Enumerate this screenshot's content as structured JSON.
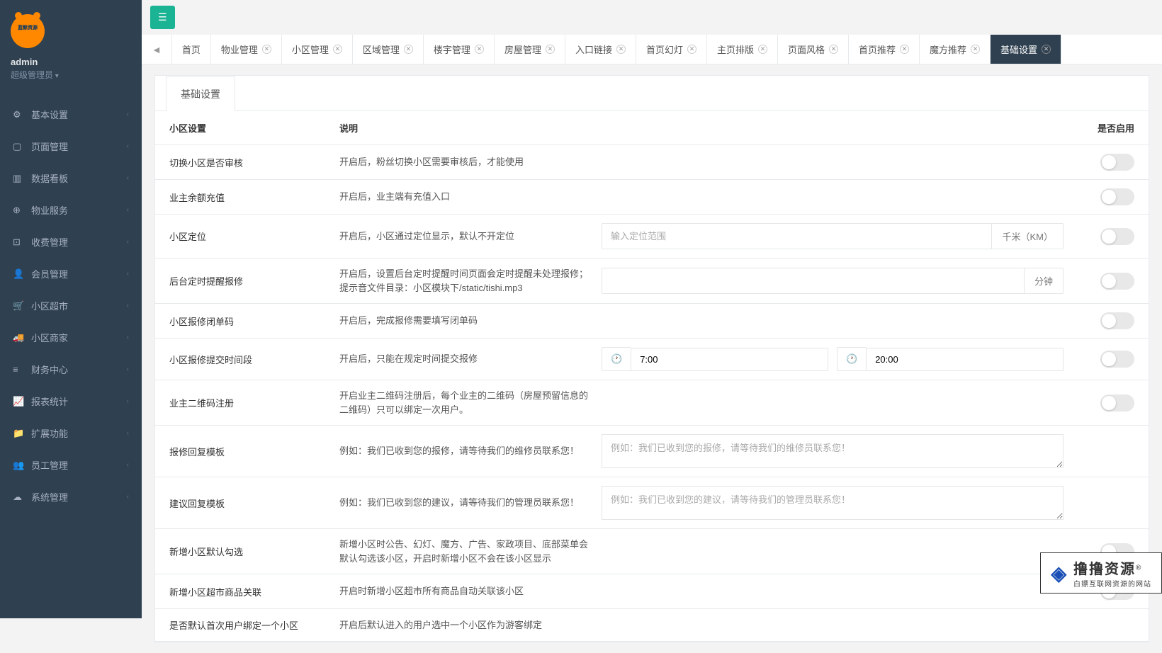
{
  "sidebar": {
    "logo_text": "蓝鲸资源",
    "username": "admin",
    "role": "超级管理员",
    "items": [
      {
        "label": "基本设置",
        "icon": "⚙"
      },
      {
        "label": "页面管理",
        "icon": "▢"
      },
      {
        "label": "数据看板",
        "icon": "▥"
      },
      {
        "label": "物业服务",
        "icon": "⊕"
      },
      {
        "label": "收费管理",
        "icon": "⊡"
      },
      {
        "label": "会员管理",
        "icon": "👤"
      },
      {
        "label": "小区超市",
        "icon": "🛒"
      },
      {
        "label": "小区商家",
        "icon": "🚚"
      },
      {
        "label": "财务中心",
        "icon": "≡"
      },
      {
        "label": "报表统计",
        "icon": "📈"
      },
      {
        "label": "扩展功能",
        "icon": "📁"
      },
      {
        "label": "员工管理",
        "icon": "👥"
      },
      {
        "label": "系统管理",
        "icon": "☁"
      }
    ]
  },
  "tabs": [
    {
      "label": "首页",
      "closable": false
    },
    {
      "label": "物业管理",
      "closable": true
    },
    {
      "label": "小区管理",
      "closable": true
    },
    {
      "label": "区域管理",
      "closable": true
    },
    {
      "label": "楼宇管理",
      "closable": true
    },
    {
      "label": "房屋管理",
      "closable": true
    },
    {
      "label": "入口链接",
      "closable": true
    },
    {
      "label": "首页幻灯",
      "closable": true
    },
    {
      "label": "主页排版",
      "closable": true
    },
    {
      "label": "页面风格",
      "closable": true
    },
    {
      "label": "首页推荐",
      "closable": true
    },
    {
      "label": "魔方推荐",
      "closable": true
    },
    {
      "label": "基础设置",
      "closable": true,
      "active": true
    }
  ],
  "panel": {
    "tab_label": "基础设置",
    "headers": {
      "name": "小区设置",
      "desc": "说明",
      "enable": "是否启用"
    }
  },
  "rows": [
    {
      "name": "切换小区是否审核",
      "desc": "开启后，粉丝切换小区需要审核后，才能使用",
      "input": null
    },
    {
      "name": "业主余额充值",
      "desc": "开启后，业主端有充值入口",
      "input": null
    },
    {
      "name": "小区定位",
      "desc": "开启后，小区通过定位显示，默认不开定位",
      "input": {
        "type": "text-addon",
        "placeholder": "输入定位范围",
        "addon": "千米（KM）"
      }
    },
    {
      "name": "后台定时提醒报修",
      "desc": "开启后，设置后台定时提醒时间页面会定时提醒未处理报修；提示音文件目录：小区模块下/static/tishi.mp3",
      "input": {
        "type": "text-addon",
        "placeholder": "",
        "addon": "分钟"
      }
    },
    {
      "name": "小区报修闭单码",
      "desc": "开启后，完成报修需要填写闭单码",
      "input": null
    },
    {
      "name": "小区报修提交时间段",
      "desc": "开启后，只能在规定时间提交报修",
      "input": {
        "type": "time-range",
        "start": "7:00",
        "end": "20:00"
      }
    },
    {
      "name": "业主二维码注册",
      "desc": "开启业主二维码注册后，每个业主的二维码（房屋预留信息的二维码）只可以绑定一次用户。",
      "input": null
    },
    {
      "name": "报修回复模板",
      "desc": "例如：我们已收到您的报修，请等待我们的维修员联系您！",
      "input": {
        "type": "textarea",
        "placeholder": "例如：我们已收到您的报修，请等待我们的维修员联系您！"
      },
      "no_toggle": true
    },
    {
      "name": "建议回复模板",
      "desc": "例如：我们已收到您的建议，请等待我们的管理员联系您！",
      "input": {
        "type": "textarea",
        "placeholder": "例如：我们已收到您的建议，请等待我们的管理员联系您！"
      },
      "no_toggle": true
    },
    {
      "name": "新增小区默认勾选",
      "desc": "新增小区时公告、幻灯、魔方、广告、家政项目、底部菜单会默认勾选该小区，开启时新增小区不会在该小区显示",
      "input": null
    },
    {
      "name": "新增小区超市商品关联",
      "desc": "开启时新增小区超市所有商品自动关联该小区",
      "input": null
    },
    {
      "name": "是否默认首次用户绑定一个小区",
      "desc": "开启后默认进入的用户选中一个小区作为游客绑定",
      "input": null,
      "no_toggle": true
    }
  ],
  "watermark": {
    "main": "撸撸资源",
    "sub": "白嫖互联网资源的网站"
  }
}
